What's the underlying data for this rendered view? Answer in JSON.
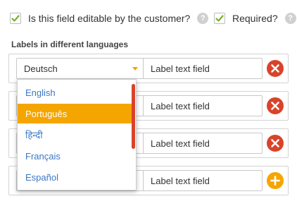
{
  "options": {
    "editable": {
      "label": "Is this field editable by the customer?",
      "checked": true
    },
    "required": {
      "label": "Required?",
      "checked": true
    },
    "help_text": "?"
  },
  "section_title": "Labels in different languages",
  "rows": [
    {
      "language": "Deutsch",
      "label_value": "Label text field",
      "action": "remove"
    },
    {
      "language": "",
      "label_value": "Label text field",
      "action": "remove"
    },
    {
      "language": "",
      "label_value": "Label text field",
      "action": "remove"
    },
    {
      "language": "",
      "label_value": "Label text field",
      "action": "add"
    }
  ],
  "dropdown": {
    "open": true,
    "items": [
      "English",
      "Português",
      "हिन्दी",
      "Français",
      "Español"
    ],
    "highlighted_index": 1
  },
  "colors": {
    "accent": "#f5a500",
    "danger": "#d9432b",
    "link": "#3b78c4",
    "check": "#7ab02c"
  }
}
